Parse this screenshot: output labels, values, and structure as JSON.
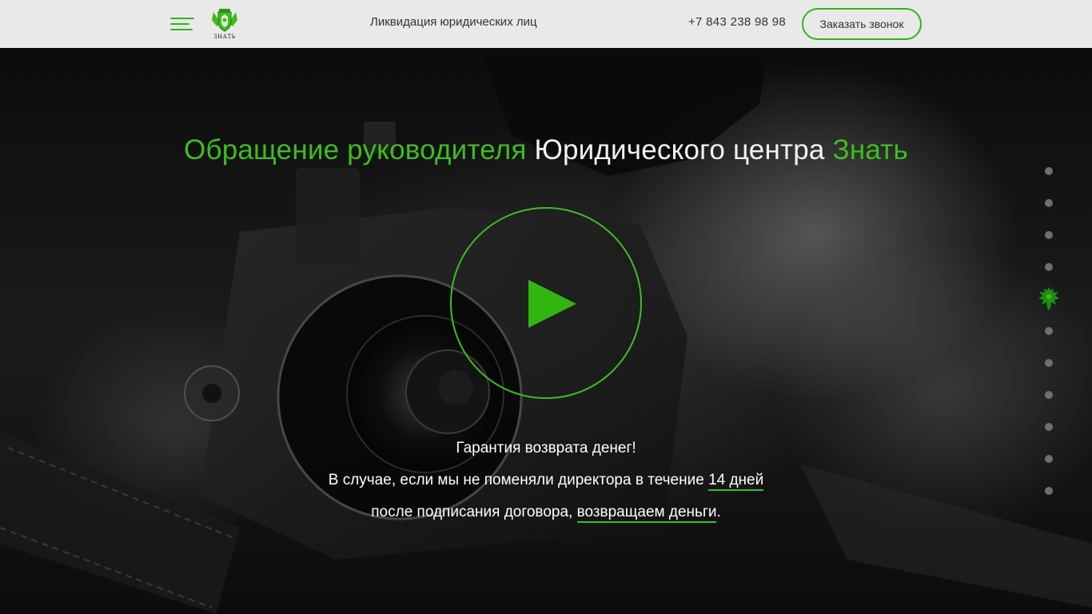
{
  "header": {
    "logo_text": "ЗНАТЬ",
    "nav_title": "Ликвидация юридических лиц",
    "phone": "+7 843 238 98 98",
    "call_button": "Заказать звонок",
    "menu_icon": "hamburger-menu-icon",
    "logo_icon": "crest-shield-icon"
  },
  "hero": {
    "title_part1": "Обращение руководителя",
    "title_part2": "Юридического центра",
    "title_part3": "Знать",
    "play_icon": "play-icon",
    "guarantee": "Гарантия возврата денег!",
    "line2_prefix": "В случае, если мы не поменяли директора в течение",
    "line2_link": "14 дней",
    "line3_prefix": "после подписания договора,",
    "line3_link": "возвращаем деньги",
    "line3_suffix": "."
  },
  "dot_nav": {
    "active_icon": "eagle-emblem-icon",
    "active_index": 4,
    "total": 11
  },
  "colors": {
    "accent": "#3cbf1c",
    "header_bg": "#e9e9e9",
    "text_dark": "#333333",
    "dot_inactive": "#6f6f6f"
  }
}
